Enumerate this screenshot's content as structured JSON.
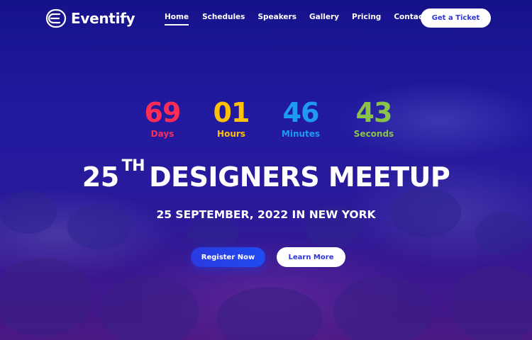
{
  "brand": {
    "name": "Eventify",
    "icon": "e-logo-icon"
  },
  "nav": {
    "items": [
      {
        "label": "Home",
        "active": true
      },
      {
        "label": "Schedules",
        "active": false
      },
      {
        "label": "Speakers",
        "active": false
      },
      {
        "label": "Gallery",
        "active": false
      },
      {
        "label": "Pricing",
        "active": false
      },
      {
        "label": "Contact",
        "active": false
      }
    ],
    "cta_label": "Get a Ticket"
  },
  "countdown": [
    {
      "value": "69",
      "label": "Days",
      "color": "#ff2d55"
    },
    {
      "value": "01",
      "label": "Hours",
      "color": "#ffc107"
    },
    {
      "value": "46",
      "label": "Minutes",
      "color": "#1e9bf0"
    },
    {
      "value": "43",
      "label": "Seconds",
      "color": "#8bc34a"
    }
  ],
  "hero": {
    "headline_number": "25",
    "headline_suffix": "TH",
    "headline_text": "DESIGNERS MEETUP",
    "subline": "25 SEPTEMBER, 2022 IN NEW YORK",
    "primary_button": "Register Now",
    "secondary_button": "Learn More"
  },
  "colors": {
    "accent": "#2d36d8",
    "background": "#1e1a8c"
  }
}
